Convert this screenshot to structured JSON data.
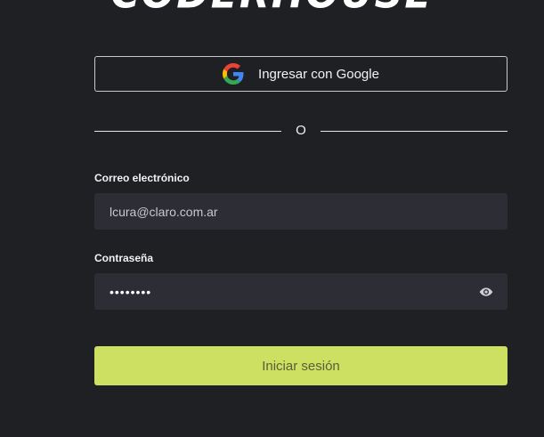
{
  "brand": {
    "logo_text": "CODERHOUSE"
  },
  "login": {
    "google_button_label": "Ingresar con Google",
    "divider_text": "O",
    "email": {
      "label": "Correo electrónico",
      "value": "lcura@claro.com.ar"
    },
    "password": {
      "label": "Contraseña",
      "masked_value": "••••••••"
    },
    "submit_label": "Iniciar sesión"
  },
  "colors": {
    "background": "#1f2024",
    "input_background": "#2c2d35",
    "accent": "#cde061",
    "google_blue": "#4285F4",
    "google_red": "#EA4335",
    "google_yellow": "#FBBC05",
    "google_green": "#34A853"
  },
  "icons": {
    "google": "google-g-icon",
    "password_toggle": "eye-icon"
  }
}
